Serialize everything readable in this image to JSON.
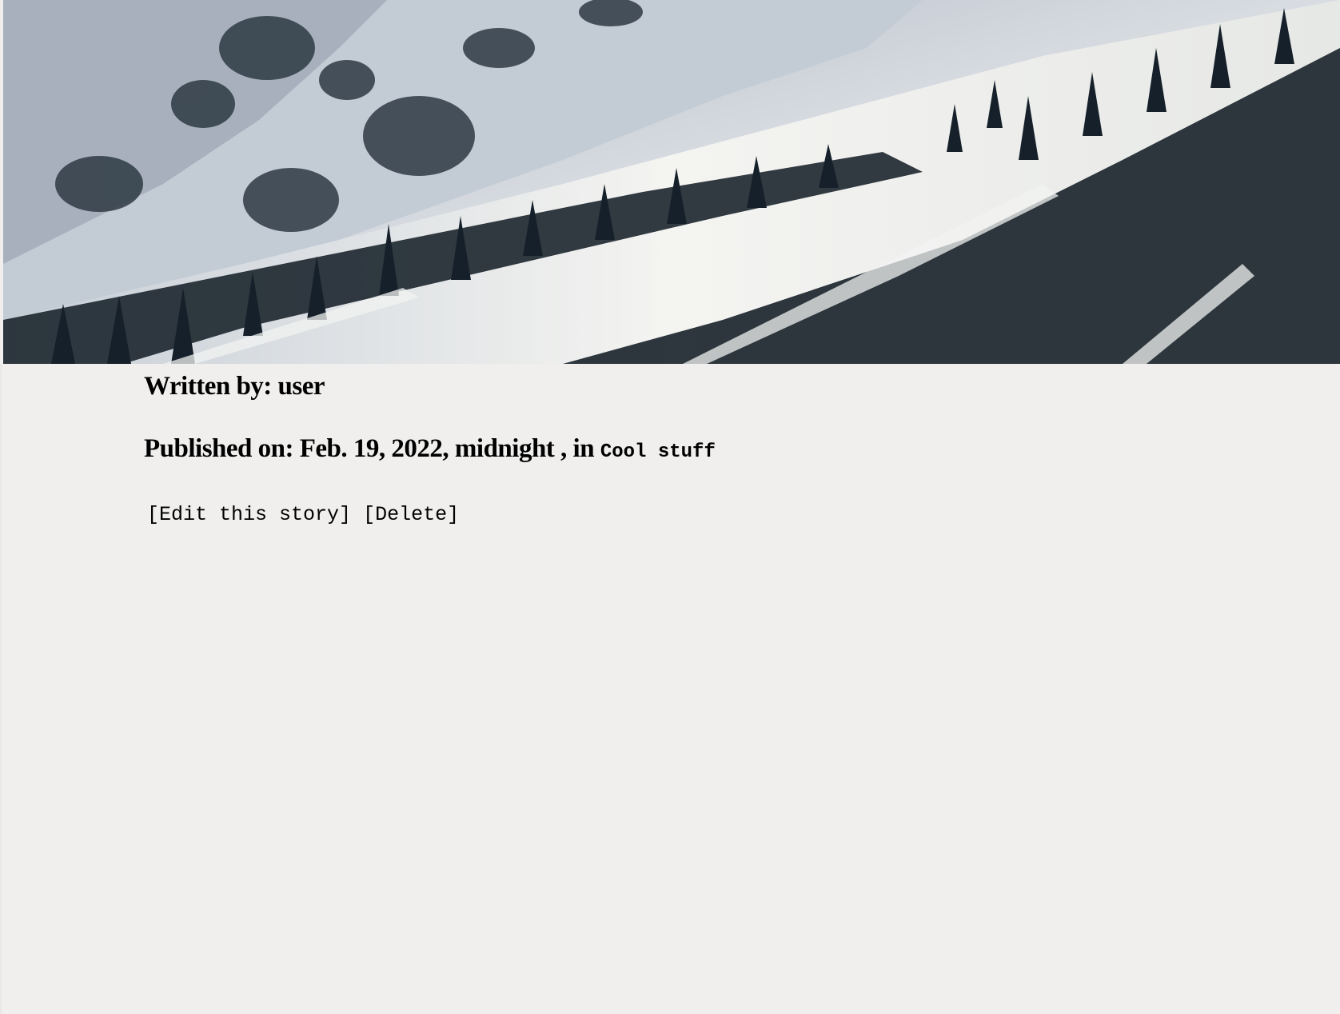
{
  "hero": {
    "image": "snowy-mountain-slope-with-pine-trees"
  },
  "story": {
    "byline_prefix": "Written by: ",
    "author": "user",
    "published_prefix": "Published on: ",
    "published_date": "Feb. 19, 2022, midnight",
    "category_separator": " , in ",
    "category": "Cool stuff"
  },
  "actions": {
    "edit_label": "[Edit this story]",
    "delete_label": "[Delete]"
  },
  "colors": {
    "page_background": "#f0efee",
    "text": "#000000"
  }
}
